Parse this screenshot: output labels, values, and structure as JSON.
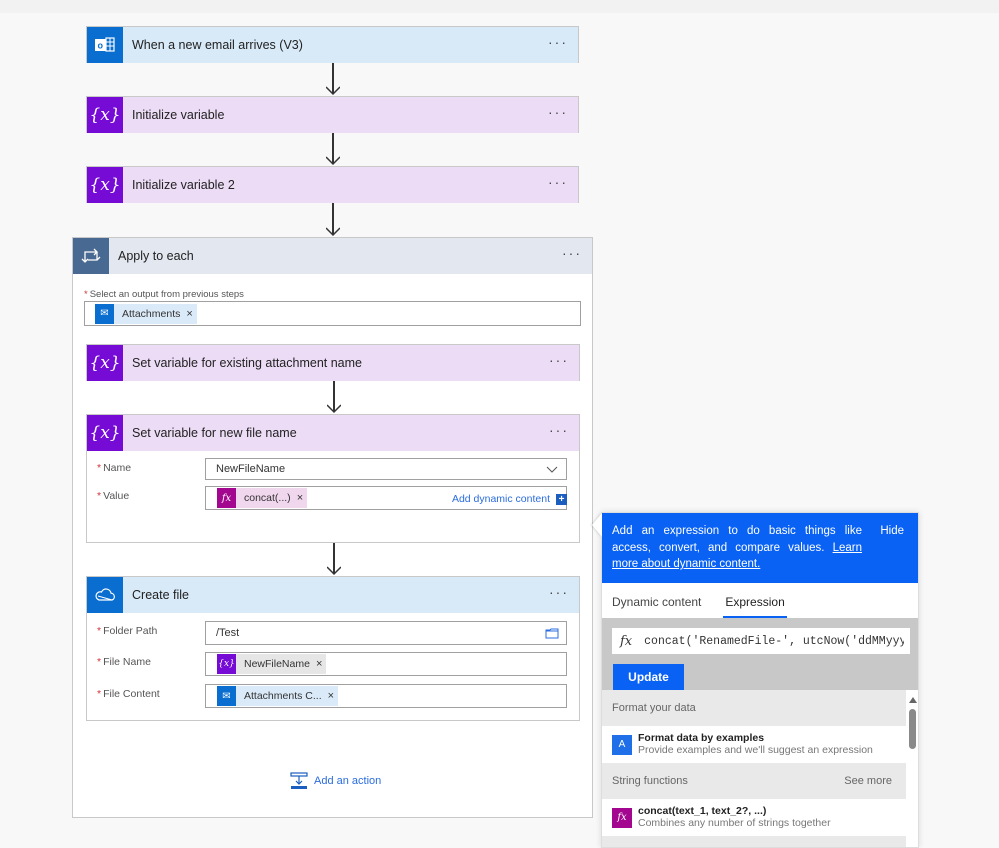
{
  "flow": {
    "trigger": {
      "title": "When a new email arrives (V3)",
      "icon": "outlook-icon"
    },
    "init_var_1": {
      "title": "Initialize variable",
      "icon": "variable-icon"
    },
    "init_var_2": {
      "title": "Initialize variable 2",
      "icon": "variable-icon"
    },
    "apply_each": {
      "title": "Apply to each",
      "icon": "loop-icon",
      "select_label": "Select an output from previous steps",
      "select_token": "Attachments",
      "set_existing": {
        "title": "Set variable for existing attachment name"
      },
      "set_new": {
        "title": "Set variable for new file name",
        "name_label": "Name",
        "name_value": "NewFileName",
        "value_label": "Value",
        "value_token": "concat(...)",
        "add_dynamic": "Add dynamic content"
      },
      "create_file": {
        "title": "Create file",
        "icon": "onedrive-icon",
        "folder_label": "Folder Path",
        "folder_value": "/Test",
        "filename_label": "File Name",
        "filename_token": "NewFileName",
        "content_label": "File Content",
        "content_token": "Attachments C..."
      },
      "add_action": "Add an action"
    },
    "more_label": "···"
  },
  "panel": {
    "description": "Add an expression to do basic things like access, convert, and compare values.",
    "learn_more": "Learn more about dynamic content.",
    "hide": "Hide",
    "tabs": [
      {
        "label": "Dynamic content",
        "active": false
      },
      {
        "label": "Expression",
        "active": true
      }
    ],
    "expression_value": "concat('RenamedFile-', utcNow('ddMMyyyyHHmm",
    "update_label": "Update",
    "sections": [
      {
        "header": "Format your data",
        "see_more": "",
        "items": [
          {
            "title": "Format data by examples",
            "desc": "Provide examples and we'll suggest an expression",
            "icon": "format-data-icon"
          }
        ]
      },
      {
        "header": "String functions",
        "see_more": "See more",
        "items": [
          {
            "title": "concat(text_1, text_2?, ...)",
            "desc": "Combines any number of strings together",
            "icon": "function-icon"
          }
        ]
      }
    ]
  },
  "colors": {
    "accent_blue": "#0a62f5",
    "variable_purple": "#770bd6",
    "outlook_blue": "#0a6ed1",
    "expression_magenta": "#a4078f"
  }
}
